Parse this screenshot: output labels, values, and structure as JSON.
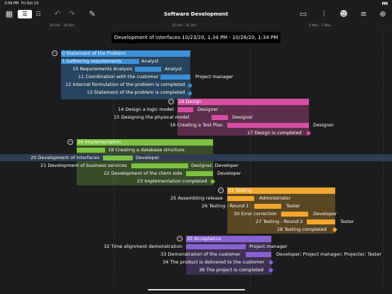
{
  "status": {
    "time": "3:09 PM",
    "date": "Fri Oct 23"
  },
  "toolbar": {
    "title": "Software Development"
  },
  "timescale": {
    "labels": [
      "16 Oct - 24 Oct",
      "25 Oct - 31 Oct",
      "1 Nov - 7 Nov"
    ]
  },
  "tooltip": {
    "text": "Development of interfaces  10/23/20, 1:34 PM - 10/26/20, 1:34 PM"
  },
  "tasks": {
    "t0": "0  Statement of the Problem",
    "t1": "1  Gathering requirements",
    "t10": "10  Requirements Analysis",
    "t11": "11  Coordination with the customer",
    "t12": "12  Internal formulation of the problem is completed",
    "t13": "13  Statement of the problem is completed",
    "t19": "19  Design",
    "t14": "14  Design a logic model",
    "t15": "15  Designing the physical model",
    "t16": "16  Creating a Test Plan",
    "t17": "17  Design is completed",
    "t24": "24  Implementation",
    "t18": "18  Creating a database structure",
    "t20": "20  Development of interfaces",
    "t21": "21  Development of business services",
    "t22": "22  Development of the client side",
    "t23": "23  Implementation completed",
    "t31": "31  Testing",
    "t25": "25  Assembling release",
    "t26": "26  Testing - Round 1",
    "t30": "30  Error correction",
    "t27": "27  Testing - Round 2",
    "t28": "28  Testing completed",
    "t35": "35  Acceptance",
    "t32": "32  Time alignment demonstration",
    "t33": "33  Demonstration of the customer",
    "t34": "34  The product is delivered to the customer",
    "t36": "36  The project is completed"
  },
  "resources": {
    "r1": "Analyst",
    "r10": "Analyst",
    "r11": "Project manager",
    "r14": "Designer",
    "r15": "Designer",
    "r16": "Designer",
    "r20": "Developer",
    "r21": "Designer; Developer",
    "r22": "Developer",
    "r25": "Administrator",
    "r26": "Tester",
    "r30": "Developer",
    "r27": "Tester",
    "r32": "Project manager",
    "r33": "Developer; Project manager; Projector; Tester"
  },
  "colors": {
    "blue": "#3d8fd6",
    "pink": "#d64fa4",
    "green": "#7cc142",
    "orange": "#f0a830",
    "purple": "#8a63d2"
  }
}
